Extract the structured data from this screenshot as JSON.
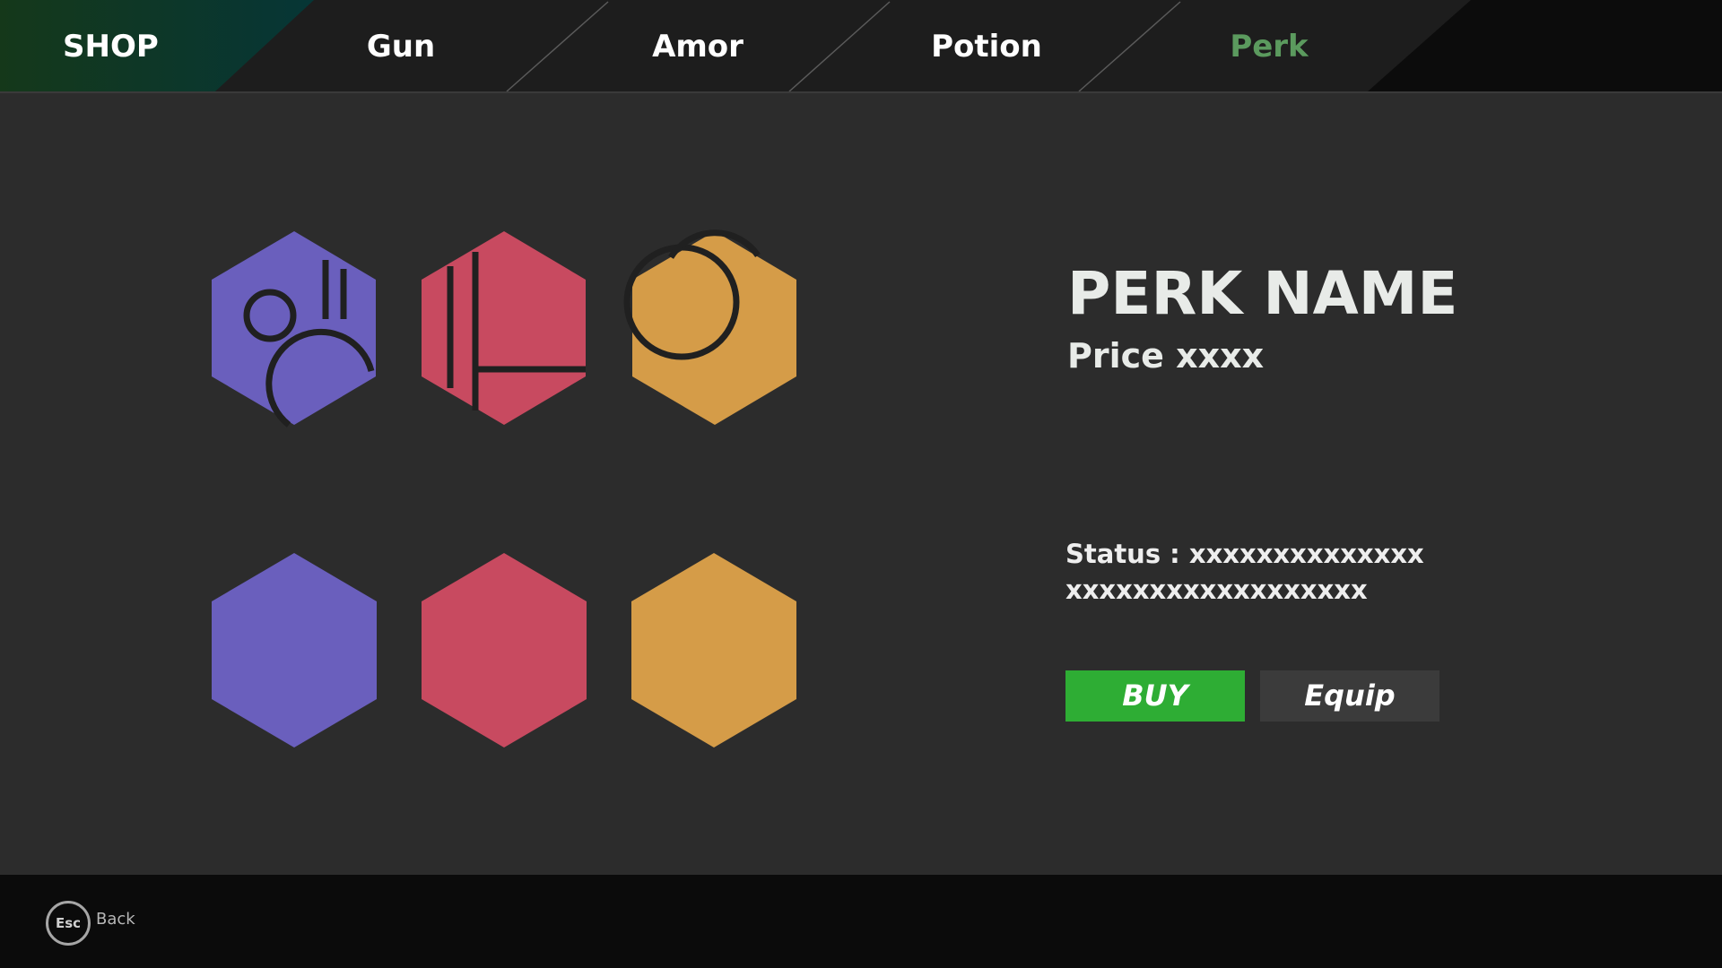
{
  "nav": {
    "title": "SHOP",
    "tabs": [
      {
        "label": "Gun",
        "active": false
      },
      {
        "label": "Amor",
        "active": false
      },
      {
        "label": "Potion",
        "active": false
      },
      {
        "label": "Perk",
        "active": true
      }
    ],
    "active_color": "#5b9a5e"
  },
  "perks": [
    {
      "color": "#6a5fbd",
      "icon": "circles-bars-icon"
    },
    {
      "color": "#c84a60",
      "icon": "lines-icon"
    },
    {
      "color": "#d59c48",
      "icon": "rings-icon"
    },
    {
      "color": "#6a5fbd",
      "icon": ""
    },
    {
      "color": "#c84a60",
      "icon": ""
    },
    {
      "color": "#d59c48",
      "icon": ""
    }
  ],
  "detail": {
    "name": "PERK NAME",
    "price": "Price xxxx",
    "status": "Status : xxxxxxxxxxxxxx xxxxxxxxxxxxxxxxxx",
    "buy_label": "BUY",
    "equip_label": "Equip",
    "buy_color": "#2ead34"
  },
  "footer": {
    "key_label": "Esc",
    "back_label": "Back"
  }
}
